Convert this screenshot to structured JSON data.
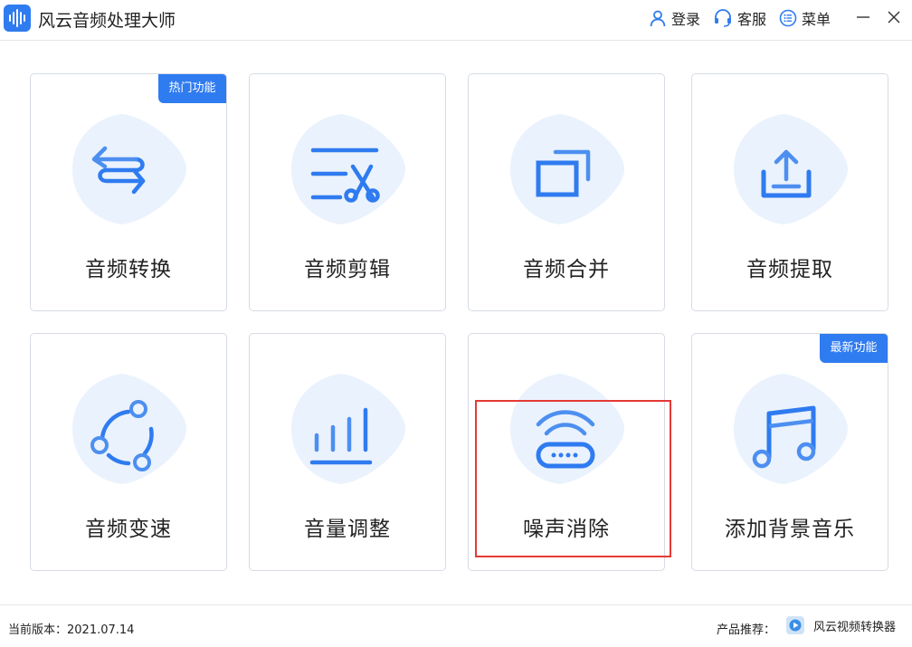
{
  "app": {
    "title": "风云音频处理大师"
  },
  "header": {
    "login": "登录",
    "service": "客服",
    "menu": "菜单"
  },
  "colors": {
    "accent": "#2f7bf0",
    "accent_light": "#4d8ff0",
    "blob": "#eaf2fd",
    "highlight": "#e53935"
  },
  "cards": [
    {
      "label": "音频转换",
      "icon": "swap-arrows-icon",
      "badge": "热门功能"
    },
    {
      "label": "音频剪辑",
      "icon": "scissors-icon",
      "badge": ""
    },
    {
      "label": "音频合并",
      "icon": "merge-squares-icon",
      "badge": ""
    },
    {
      "label": "音频提取",
      "icon": "upload-tray-icon",
      "badge": ""
    },
    {
      "label": "音频变速",
      "icon": "cycle-dots-icon",
      "badge": ""
    },
    {
      "label": "音量调整",
      "icon": "volume-bars-icon",
      "badge": ""
    },
    {
      "label": "噪声消除",
      "icon": "wifi-router-icon",
      "badge": ""
    },
    {
      "label": "添加背景音乐",
      "icon": "music-note-icon",
      "badge": "最新功能"
    }
  ],
  "footer": {
    "version": "当前版本：2021.07.14",
    "recommend_label": "产品推荐：",
    "recommend_product": "风云视频转换器"
  }
}
